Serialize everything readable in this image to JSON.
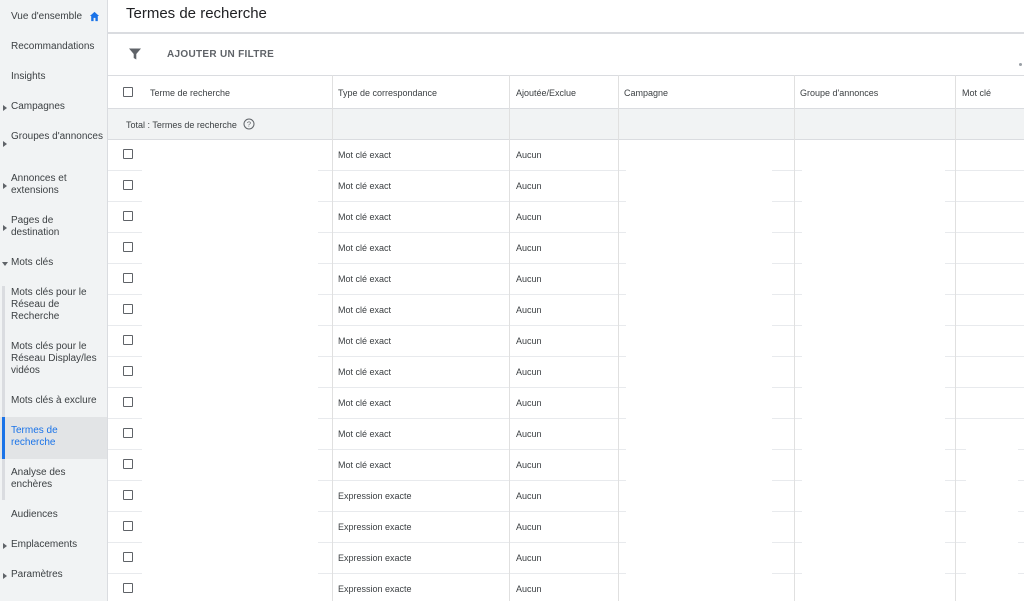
{
  "sidebar": {
    "items": [
      {
        "label": "Vue d'ensemble"
      },
      {
        "label": "Recommandations"
      },
      {
        "label": "Insights"
      },
      {
        "label": "Campagnes"
      },
      {
        "label": "Groupes d'annonces"
      },
      {
        "label": "Annonces et extensions"
      },
      {
        "label": "Pages de destination"
      },
      {
        "label": "Mots clés"
      },
      {
        "label": "Mots clés pour le Réseau de Recherche"
      },
      {
        "label": "Mots clés pour le Réseau Display/les vidéos"
      },
      {
        "label": "Mots clés à exclure"
      },
      {
        "label": "Termes de recherche"
      },
      {
        "label": "Analyse des enchères"
      },
      {
        "label": "Audiences"
      },
      {
        "label": "Emplacements"
      },
      {
        "label": "Paramètres"
      }
    ]
  },
  "header": {
    "title": "Termes de recherche"
  },
  "toolbar": {
    "filter_label": "AJOUTER UN FILTRE"
  },
  "table": {
    "columns": [
      "Terme de recherche",
      "Type de correspondance",
      "Ajoutée/Exclue",
      "Campagne",
      "Groupe d'annonces",
      "Mot clé"
    ],
    "total_label": "Total : Termes de recherche",
    "rows": [
      {
        "match": "Mot clé exact",
        "added": "Aucun"
      },
      {
        "match": "Mot clé exact",
        "added": "Aucun"
      },
      {
        "match": "Mot clé exact",
        "added": "Aucun"
      },
      {
        "match": "Mot clé exact",
        "added": "Aucun"
      },
      {
        "match": "Mot clé exact",
        "added": "Aucun"
      },
      {
        "match": "Mot clé exact",
        "added": "Aucun"
      },
      {
        "match": "Mot clé exact",
        "added": "Aucun"
      },
      {
        "match": "Mot clé exact",
        "added": "Aucun"
      },
      {
        "match": "Mot clé exact",
        "added": "Aucun"
      },
      {
        "match": "Mot clé exact",
        "added": "Aucun"
      },
      {
        "match": "Mot clé exact",
        "added": "Aucun"
      },
      {
        "match": "Expression exacte",
        "added": "Aucun"
      },
      {
        "match": "Expression exacte",
        "added": "Aucun"
      },
      {
        "match": "Expression exacte",
        "added": "Aucun"
      },
      {
        "match": "Expression exacte",
        "added": "Aucun"
      }
    ]
  },
  "colors": {
    "accent": "#1a73e8",
    "sidebar_bg": "#f1f3f4",
    "border": "#dadce0"
  }
}
